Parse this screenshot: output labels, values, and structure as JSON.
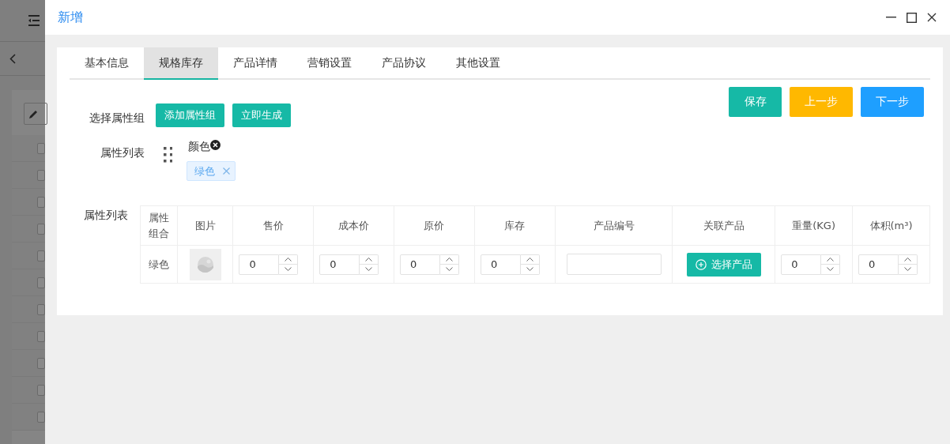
{
  "background_page": {
    "row_checkboxes": [
      {
        "checked": false
      },
      {
        "checked": false
      },
      {
        "checked": false
      },
      {
        "checked": false
      },
      {
        "checked": false
      },
      {
        "checked": false
      },
      {
        "checked": false
      },
      {
        "checked": false
      },
      {
        "checked": false
      },
      {
        "checked": false
      },
      {
        "checked": false
      }
    ]
  },
  "dialog": {
    "title": "新增"
  },
  "tabs": [
    {
      "label": "基本信息",
      "selected": false
    },
    {
      "label": "规格库存",
      "selected": true
    },
    {
      "label": "产品详情",
      "selected": false
    },
    {
      "label": "营销设置",
      "selected": false
    },
    {
      "label": "产品协议",
      "selected": false
    },
    {
      "label": "其他设置",
      "selected": false
    }
  ],
  "actions": [
    {
      "label": "保存",
      "kind": "save"
    },
    {
      "label": "上一步",
      "kind": "prev"
    },
    {
      "label": "下一步",
      "kind": "next"
    }
  ],
  "attribute_group": {
    "label": "选择属性组",
    "buttons": [
      "添加属性组",
      "立即生成"
    ]
  },
  "attribute_list": {
    "label": "属性列表",
    "attributes": [
      {
        "name": "颜色",
        "values": [
          "绿色"
        ]
      }
    ]
  },
  "sku_table": {
    "label": "属性列表",
    "columns": [
      "属性组合",
      "图片",
      "售价",
      "成本价",
      "原价",
      "库存",
      "产品编号",
      "关联产品",
      "重量(KG)",
      "体积(m³)"
    ],
    "rows": [
      {
        "combination": "绿色",
        "price": "0",
        "cost": "0",
        "original": "0",
        "stock": "0",
        "code": "",
        "product_button": "选择产品",
        "weight": "0",
        "volume": "0"
      }
    ]
  }
}
